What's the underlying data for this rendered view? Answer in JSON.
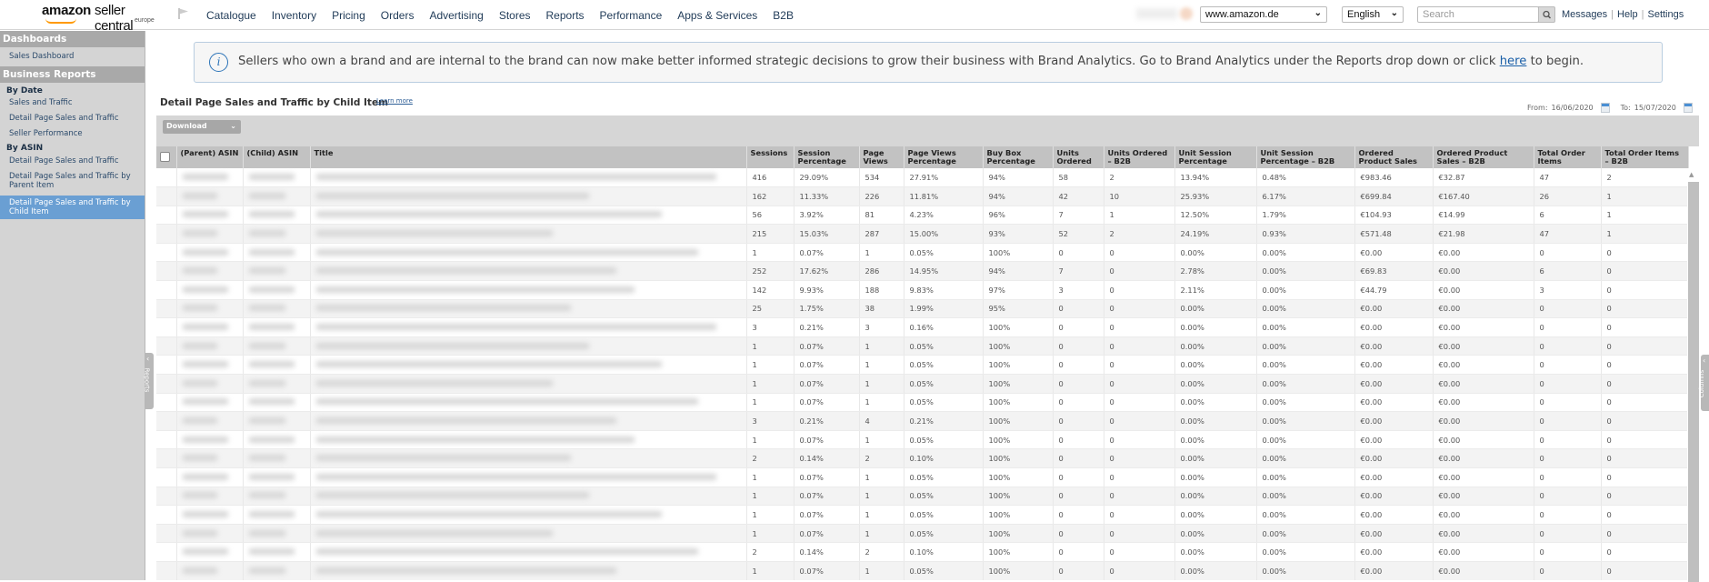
{
  "header": {
    "logo_amazon": "amazon",
    "logo_product": "seller central",
    "logo_region": "europe",
    "nav": [
      "Catalogue",
      "Inventory",
      "Pricing",
      "Orders",
      "Advertising",
      "Stores",
      "Reports",
      "Performance",
      "Apps & Services",
      "B2B"
    ],
    "marketplace": "www.amazon.de",
    "language": "English",
    "search_placeholder": "Search",
    "links": [
      "Messages",
      "Help",
      "Settings"
    ]
  },
  "sidebar": {
    "sections": [
      {
        "title": "Dashboards",
        "items": [
          {
            "label": "Sales Dashboard"
          }
        ]
      },
      {
        "title": "Business Reports"
      }
    ],
    "by_date_label": "By Date",
    "by_date_items": [
      "Sales and Traffic",
      "Detail Page Sales and Traffic",
      "Seller Performance"
    ],
    "by_asin_label": "By ASIN",
    "by_asin_items": [
      "Detail Page Sales and Traffic",
      "Detail Page Sales and Traffic by Parent Item",
      "Detail Page Sales and Traffic by Child Item"
    ],
    "active_item": "Detail Page Sales and Traffic by Child Item",
    "collapse_tab": "Reports"
  },
  "banner": {
    "text_before": "Sellers who own a brand and are internal to the brand can now make better informed strategic decisions to grow their business with Brand Analytics. Go to Brand Analytics under the Reports drop down or click ",
    "link": "here",
    "text_after": " to begin."
  },
  "report": {
    "title": "Detail Page Sales and Traffic by Child Item",
    "learn_more": "Learn more",
    "from_label": "From:",
    "from_date": "16/06/2020",
    "to_label": "To:",
    "to_date": "15/07/2020",
    "download_label": "Download",
    "columns_tab": "Columns"
  },
  "table": {
    "headers": [
      "(Parent) ASIN",
      "(Child) ASIN",
      "Title",
      "Sessions",
      "Session Percentage",
      "Page Views",
      "Page Views Percentage",
      "Buy Box Percentage",
      "Units Ordered",
      "Units Ordered – B2B",
      "Unit Session Percentage",
      "Unit Session Percentage – B2B",
      "Ordered Product Sales",
      "Ordered Product Sales – B2B",
      "Total Order Items",
      "Total Order Items – B2B"
    ],
    "rows": [
      [
        "416",
        "29.09%",
        "534",
        "27.91%",
        "94%",
        "58",
        "2",
        "13.94%",
        "0.48%",
        "€983.46",
        "€32.87",
        "47",
        "2"
      ],
      [
        "162",
        "11.33%",
        "226",
        "11.81%",
        "94%",
        "42",
        "10",
        "25.93%",
        "6.17%",
        "€699.84",
        "€167.40",
        "26",
        "1"
      ],
      [
        "56",
        "3.92%",
        "81",
        "4.23%",
        "96%",
        "7",
        "1",
        "12.50%",
        "1.79%",
        "€104.93",
        "€14.99",
        "6",
        "1"
      ],
      [
        "215",
        "15.03%",
        "287",
        "15.00%",
        "93%",
        "52",
        "2",
        "24.19%",
        "0.93%",
        "€571.48",
        "€21.98",
        "47",
        "1"
      ],
      [
        "1",
        "0.07%",
        "1",
        "0.05%",
        "100%",
        "0",
        "0",
        "0.00%",
        "0.00%",
        "€0.00",
        "€0.00",
        "0",
        "0"
      ],
      [
        "252",
        "17.62%",
        "286",
        "14.95%",
        "94%",
        "7",
        "0",
        "2.78%",
        "0.00%",
        "€69.83",
        "€0.00",
        "6",
        "0"
      ],
      [
        "142",
        "9.93%",
        "188",
        "9.83%",
        "97%",
        "3",
        "0",
        "2.11%",
        "0.00%",
        "€44.79",
        "€0.00",
        "3",
        "0"
      ],
      [
        "25",
        "1.75%",
        "38",
        "1.99%",
        "95%",
        "0",
        "0",
        "0.00%",
        "0.00%",
        "€0.00",
        "€0.00",
        "0",
        "0"
      ],
      [
        "3",
        "0.21%",
        "3",
        "0.16%",
        "100%",
        "0",
        "0",
        "0.00%",
        "0.00%",
        "€0.00",
        "€0.00",
        "0",
        "0"
      ],
      [
        "1",
        "0.07%",
        "1",
        "0.05%",
        "100%",
        "0",
        "0",
        "0.00%",
        "0.00%",
        "€0.00",
        "€0.00",
        "0",
        "0"
      ],
      [
        "1",
        "0.07%",
        "1",
        "0.05%",
        "100%",
        "0",
        "0",
        "0.00%",
        "0.00%",
        "€0.00",
        "€0.00",
        "0",
        "0"
      ],
      [
        "1",
        "0.07%",
        "1",
        "0.05%",
        "100%",
        "0",
        "0",
        "0.00%",
        "0.00%",
        "€0.00",
        "€0.00",
        "0",
        "0"
      ],
      [
        "1",
        "0.07%",
        "1",
        "0.05%",
        "100%",
        "0",
        "0",
        "0.00%",
        "0.00%",
        "€0.00",
        "€0.00",
        "0",
        "0"
      ],
      [
        "3",
        "0.21%",
        "4",
        "0.21%",
        "100%",
        "0",
        "0",
        "0.00%",
        "0.00%",
        "€0.00",
        "€0.00",
        "0",
        "0"
      ],
      [
        "1",
        "0.07%",
        "1",
        "0.05%",
        "100%",
        "0",
        "0",
        "0.00%",
        "0.00%",
        "€0.00",
        "€0.00",
        "0",
        "0"
      ],
      [
        "2",
        "0.14%",
        "2",
        "0.10%",
        "100%",
        "0",
        "0",
        "0.00%",
        "0.00%",
        "€0.00",
        "€0.00",
        "0",
        "0"
      ],
      [
        "1",
        "0.07%",
        "1",
        "0.05%",
        "100%",
        "0",
        "0",
        "0.00%",
        "0.00%",
        "€0.00",
        "€0.00",
        "0",
        "0"
      ],
      [
        "1",
        "0.07%",
        "1",
        "0.05%",
        "100%",
        "0",
        "0",
        "0.00%",
        "0.00%",
        "€0.00",
        "€0.00",
        "0",
        "0"
      ],
      [
        "1",
        "0.07%",
        "1",
        "0.05%",
        "100%",
        "0",
        "0",
        "0.00%",
        "0.00%",
        "€0.00",
        "€0.00",
        "0",
        "0"
      ],
      [
        "1",
        "0.07%",
        "1",
        "0.05%",
        "100%",
        "0",
        "0",
        "0.00%",
        "0.00%",
        "€0.00",
        "€0.00",
        "0",
        "0"
      ],
      [
        "2",
        "0.14%",
        "2",
        "0.10%",
        "100%",
        "0",
        "0",
        "0.00%",
        "0.00%",
        "€0.00",
        "€0.00",
        "0",
        "0"
      ],
      [
        "1",
        "0.07%",
        "1",
        "0.05%",
        "100%",
        "0",
        "0",
        "0.00%",
        "0.00%",
        "€0.00",
        "€0.00",
        "0",
        "0"
      ]
    ]
  }
}
